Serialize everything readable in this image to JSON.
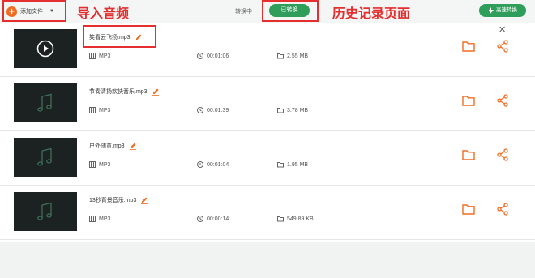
{
  "toolbar": {
    "add_file_label": "添加文件",
    "tab_converting": "转换中",
    "tab_converted": "已转换",
    "fast_convert": "高速转换"
  },
  "annotations": {
    "import_audio": "导入音频",
    "history_page": "历史记录页面"
  },
  "colors": {
    "accent_orange": "#f26b21",
    "accent_green": "#2f9e5a",
    "annotation_red": "#e52e2e"
  },
  "files": [
    {
      "name": "笑看云飞扬.mp3",
      "format": "MP3",
      "duration": "00:01:06",
      "size": "2.55 MB"
    },
    {
      "name": "节奏清扬欢快音乐.mp3",
      "format": "MP3",
      "duration": "00:01:39",
      "size": "3.78 MB"
    },
    {
      "name": "户外随意.mp3",
      "format": "MP3",
      "duration": "00:01:04",
      "size": "1.95 MB"
    },
    {
      "name": "13秒背景音乐.mp3",
      "format": "MP3",
      "duration": "00:00:14",
      "size": "549.89 KB"
    }
  ]
}
